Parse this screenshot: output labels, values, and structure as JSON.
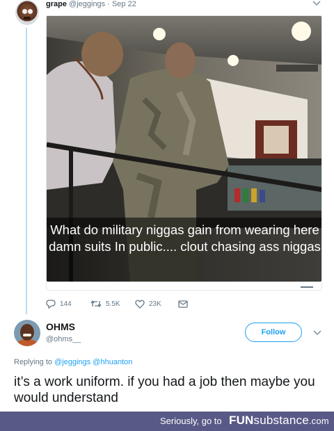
{
  "tweet": {
    "display_name": "grape",
    "handle": "@jeggings",
    "separator": " · ",
    "date": "Sep 22",
    "avatar_icon": "user-avatar-face",
    "image_caption": "What do military niggas gain from wearing here damn suits In public.... clout chasing ass niggas",
    "actions": {
      "reply_count": "144",
      "retweet_count": "5.5K",
      "like_count": "23K"
    }
  },
  "reply": {
    "display_name": "OHMS",
    "handle": "@ohms__",
    "follow_label": "Follow",
    "replying_to_prefix": "Replying to",
    "replying_to_mentions": "@jeggings @hhuanton",
    "body": "it’s a work uniform. if you had a job then maybe you would understand"
  },
  "watermark": {
    "prefix": "Seriously, go to",
    "logo_strong": "FUN",
    "logo_rest": "substance",
    "logo_tld": ".com",
    "bar_color": "#595987"
  },
  "colors": {
    "accent": "#1da1f2",
    "muted_text": "#657786",
    "thread_line": "#b8dcf3"
  }
}
